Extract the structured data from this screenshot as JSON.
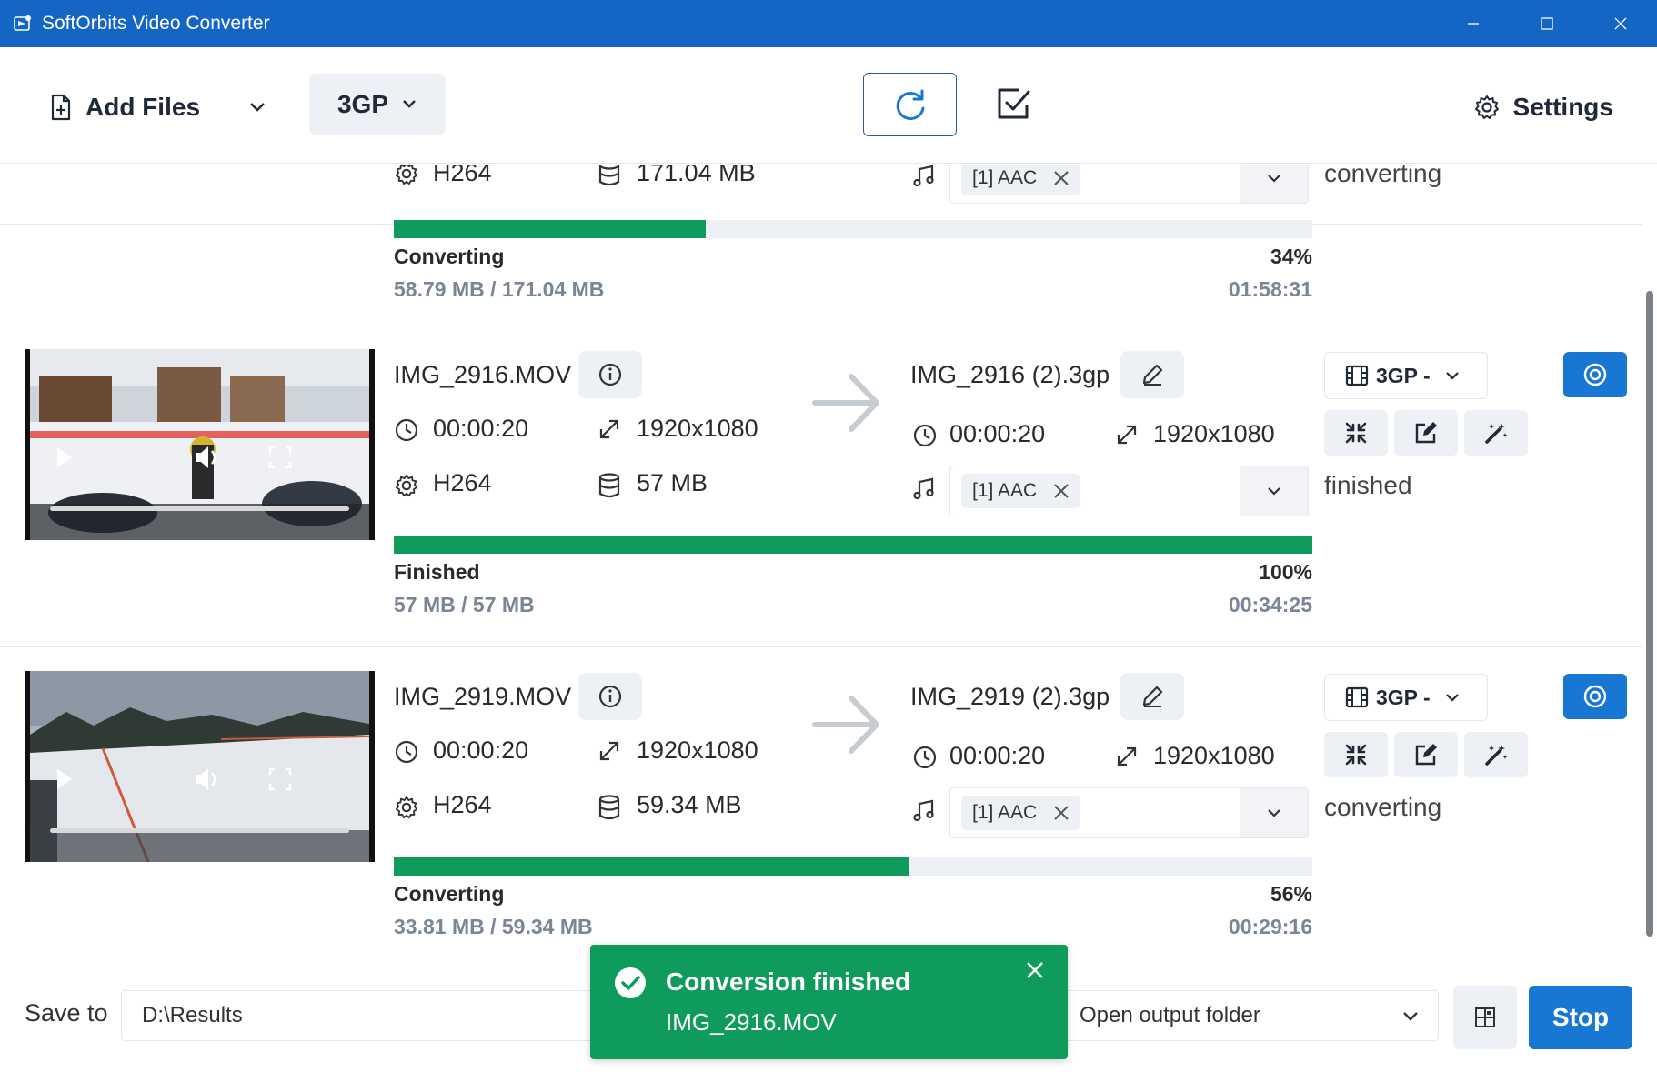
{
  "window": {
    "title": "SoftOrbits Video Converter",
    "titlebar_color": "#1566c4"
  },
  "toolbar": {
    "add_files_label": "Add Files",
    "format_label": "3GP",
    "settings_label": "Settings"
  },
  "files": [
    {
      "source_name": "",
      "duration": "",
      "resolution": "",
      "codec": "H264",
      "size": "171.04 MB",
      "output_name": "",
      "output_duration": "",
      "output_resolution": "",
      "audio_track": "[1] AAC",
      "format": "3GP",
      "state": "converting",
      "progress_label": "Converting",
      "progress_percent_text": "34%",
      "progress_fraction": 0.34,
      "progress_size": "58.79 MB / 171.04 MB",
      "time": "01:58:31"
    },
    {
      "source_name": "IMG_2916.MOV",
      "duration": "00:00:20",
      "resolution": "1920x1080",
      "codec": "H264",
      "size": "57 MB",
      "output_name": "IMG_2916 (2).3gp",
      "output_duration": "00:00:20",
      "output_resolution": "1920x1080",
      "audio_track": "[1] AAC",
      "format": "3GP -",
      "state": "finished",
      "progress_label": "Finished",
      "progress_percent_text": "100%",
      "progress_fraction": 1.0,
      "progress_size": "57 MB / 57 MB",
      "time": "00:34:25"
    },
    {
      "source_name": "IMG_2919.MOV",
      "duration": "00:00:20",
      "resolution": "1920x1080",
      "codec": "H264",
      "size": "59.34 MB",
      "output_name": "IMG_2919 (2).3gp",
      "output_duration": "00:00:20",
      "output_resolution": "1920x1080",
      "audio_track": "[1] AAC",
      "format": "3GP -",
      "state": "converting",
      "progress_label": "Converting",
      "progress_percent_text": "56%",
      "progress_fraction": 0.56,
      "progress_size": "33.81 MB / 59.34 MB",
      "time": "00:29:16"
    }
  ],
  "bottom": {
    "save_to_label": "Save to",
    "save_path": "D:\\Results",
    "after_action": "Open output folder",
    "stop_label": "Stop"
  },
  "toast": {
    "title": "Conversion finished",
    "message": "IMG_2916.MOV"
  },
  "colors": {
    "accent": "#1877d3",
    "progress": "#0f9b5b",
    "progress_track": "#edf1f5",
    "toast_bg": "#0f9b5b"
  }
}
